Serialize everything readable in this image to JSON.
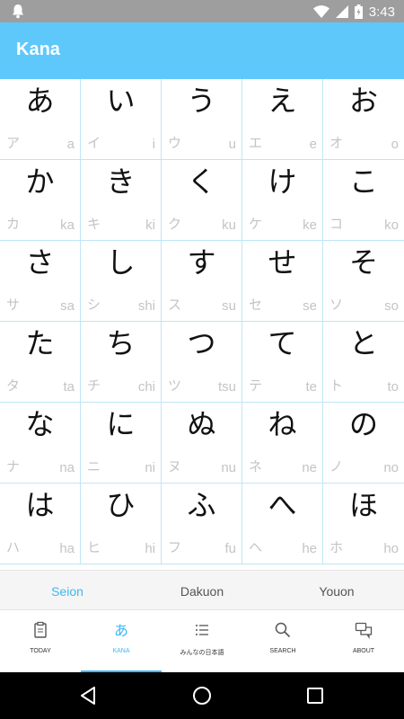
{
  "status_bar": {
    "time": "3:43"
  },
  "app": {
    "title": "Kana"
  },
  "kana_rows": [
    [
      {
        "hira": "あ",
        "kata": "ア",
        "roma": "a"
      },
      {
        "hira": "い",
        "kata": "イ",
        "roma": "i"
      },
      {
        "hira": "う",
        "kata": "ウ",
        "roma": "u"
      },
      {
        "hira": "え",
        "kata": "エ",
        "roma": "e"
      },
      {
        "hira": "お",
        "kata": "オ",
        "roma": "o"
      }
    ],
    [
      {
        "hira": "か",
        "kata": "カ",
        "roma": "ka"
      },
      {
        "hira": "き",
        "kata": "キ",
        "roma": "ki"
      },
      {
        "hira": "く",
        "kata": "ク",
        "roma": "ku"
      },
      {
        "hira": "け",
        "kata": "ケ",
        "roma": "ke"
      },
      {
        "hira": "こ",
        "kata": "コ",
        "roma": "ko"
      }
    ],
    [
      {
        "hira": "さ",
        "kata": "サ",
        "roma": "sa"
      },
      {
        "hira": "し",
        "kata": "シ",
        "roma": "shi"
      },
      {
        "hira": "す",
        "kata": "ス",
        "roma": "su"
      },
      {
        "hira": "せ",
        "kata": "セ",
        "roma": "se"
      },
      {
        "hira": "そ",
        "kata": "ソ",
        "roma": "so"
      }
    ],
    [
      {
        "hira": "た",
        "kata": "タ",
        "roma": "ta"
      },
      {
        "hira": "ち",
        "kata": "チ",
        "roma": "chi"
      },
      {
        "hira": "つ",
        "kata": "ツ",
        "roma": "tsu"
      },
      {
        "hira": "て",
        "kata": "テ",
        "roma": "te"
      },
      {
        "hira": "と",
        "kata": "ト",
        "roma": "to"
      }
    ],
    [
      {
        "hira": "な",
        "kata": "ナ",
        "roma": "na"
      },
      {
        "hira": "に",
        "kata": "ニ",
        "roma": "ni"
      },
      {
        "hira": "ぬ",
        "kata": "ヌ",
        "roma": "nu"
      },
      {
        "hira": "ね",
        "kata": "ネ",
        "roma": "ne"
      },
      {
        "hira": "の",
        "kata": "ノ",
        "roma": "no"
      }
    ],
    [
      {
        "hira": "は",
        "kata": "ハ",
        "roma": "ha"
      },
      {
        "hira": "ひ",
        "kata": "ヒ",
        "roma": "hi"
      },
      {
        "hira": "ふ",
        "kata": "フ",
        "roma": "fu"
      },
      {
        "hira": "へ",
        "kata": "ヘ",
        "roma": "he"
      },
      {
        "hira": "ほ",
        "kata": "ホ",
        "roma": "ho"
      }
    ]
  ],
  "sub_tabs": [
    {
      "label": "Seion",
      "active": true
    },
    {
      "label": "Dakuon",
      "active": false
    },
    {
      "label": "Youon",
      "active": false
    }
  ],
  "bottom_nav": [
    {
      "label": "TODAY",
      "icon": "clipboard-icon",
      "active": false
    },
    {
      "label": "KANA",
      "icon": "kana-a-icon",
      "active": true
    },
    {
      "label": "みんなの日本語",
      "icon": "list-icon",
      "active": false
    },
    {
      "label": "SEARCH",
      "icon": "search-icon",
      "active": false
    },
    {
      "label": "ABOUT",
      "icon": "chat-icon",
      "active": false
    }
  ],
  "colors": {
    "accent": "#3fb7f2",
    "app_bar": "#5fc8fb",
    "status_bar": "#9e9e9e",
    "grid_line": "#bfe6f5"
  }
}
